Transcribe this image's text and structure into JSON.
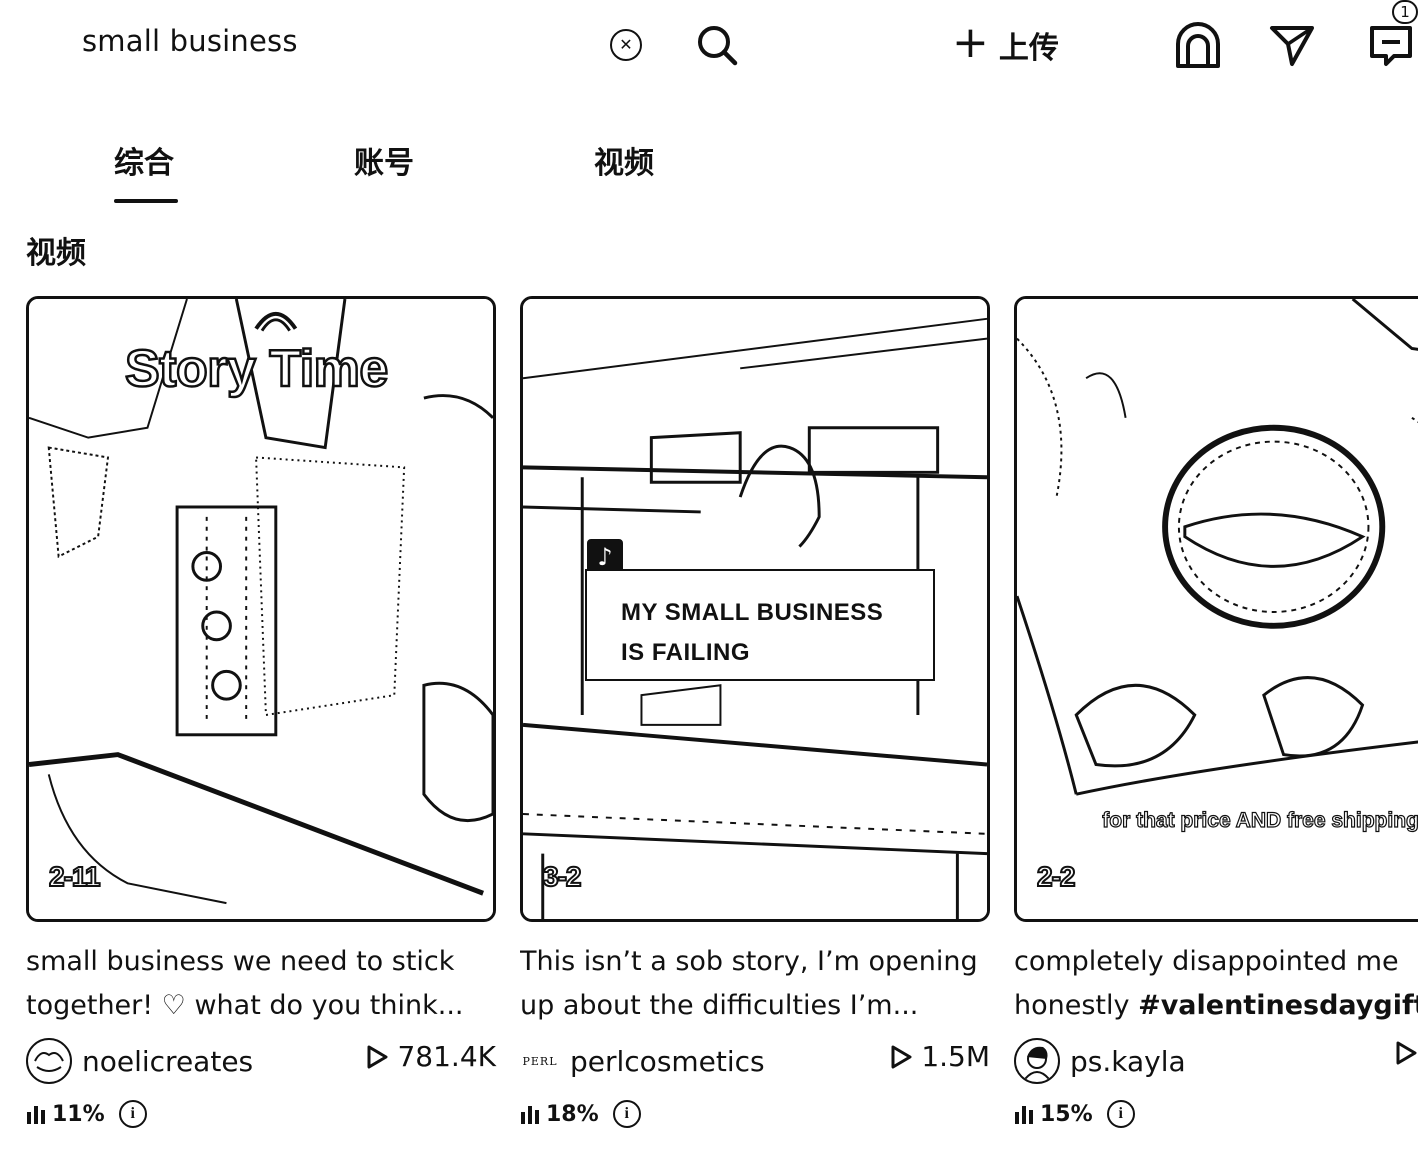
{
  "search": {
    "query": "small business",
    "clear_icon": "clear-icon"
  },
  "header": {
    "upload_label": "上传",
    "message_badge": "1"
  },
  "tabs": [
    {
      "label": "综合",
      "active": true
    },
    {
      "label": "账号",
      "active": false
    },
    {
      "label": "视频",
      "active": false
    }
  ],
  "section": {
    "title": "视频"
  },
  "videos": [
    {
      "date": "2-11",
      "overlay_text": "Story Time",
      "desc_line1": "small business we need to stick",
      "desc_line2": "together! ♡ what do you think...",
      "author": "noelicreates",
      "views": "781.4K",
      "percent": "11%"
    },
    {
      "date": "3-2",
      "overlay_text_line1": "MY SMALL BUSINESS",
      "overlay_text_line2": "IS FAILING",
      "desc_line1": "This isn’t a sob story, I’m opening",
      "desc_line2": "up about the difficulties I’m...",
      "author": "perlcosmetics",
      "avatar_text": "PERL",
      "views": "1.5M",
      "percent": "18%"
    },
    {
      "date": "2-2",
      "overlay_text": "for that price AND free shipping?",
      "desc_line1": "completely disappointed me",
      "desc_line2_prefix": "honestly ",
      "desc_line2_tag": "#valentinesdaygifts",
      "author": "ps.kayla",
      "percent": "15%"
    }
  ],
  "colors": {
    "text": "#111111",
    "background": "#ffffff"
  }
}
